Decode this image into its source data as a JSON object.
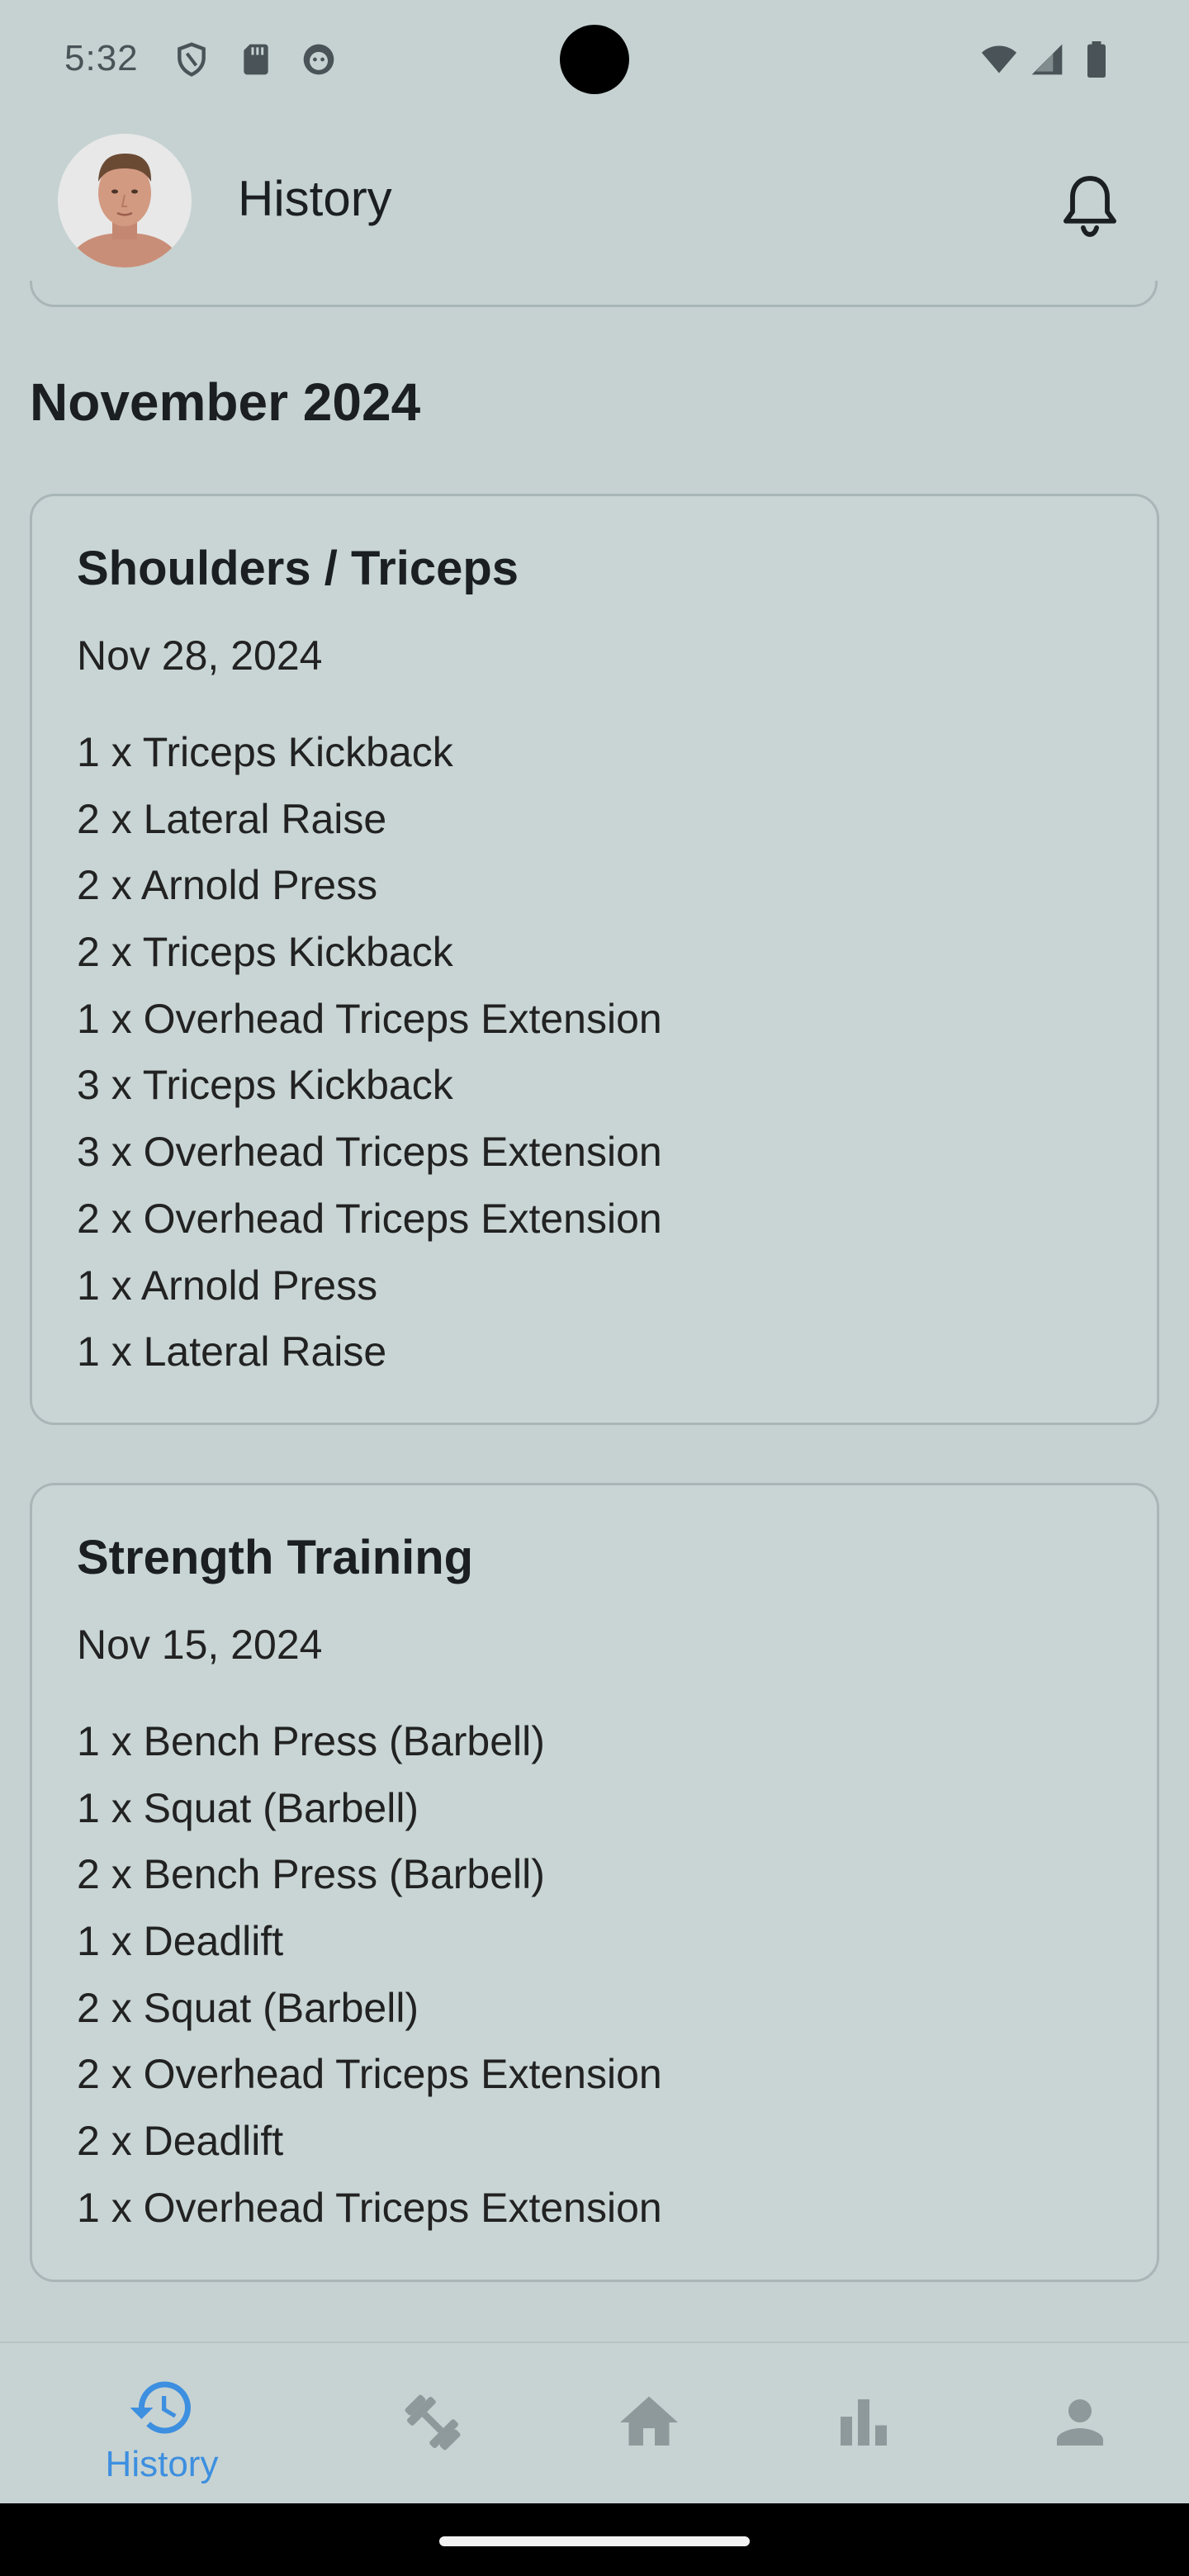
{
  "status_bar": {
    "time": "5:32",
    "icons": [
      "shield-icon",
      "sd-card-icon",
      "game-icon",
      "wifi-icon",
      "signal-icon",
      "battery-icon"
    ]
  },
  "header": {
    "title": "History",
    "avatar": "profile-photo",
    "action_icon": "bell-icon"
  },
  "month": "November 2024",
  "workouts": [
    {
      "title": "Shoulders / Triceps",
      "date": "Nov 28, 2024",
      "exercises": [
        "1 x Triceps Kickback",
        "2 x Lateral Raise",
        "2 x Arnold Press",
        "2 x Triceps Kickback",
        "1 x Overhead Triceps Extension",
        "3 x Triceps Kickback",
        "3 x Overhead Triceps Extension",
        "2 x Overhead Triceps Extension",
        "1 x Arnold Press",
        "1 x Lateral Raise"
      ]
    },
    {
      "title": "Strength Training",
      "date": "Nov 15, 2024",
      "exercises": [
        "1 x Bench Press (Barbell)",
        "1 x Squat (Barbell)",
        "2 x Bench Press (Barbell)",
        "1 x Deadlift",
        "2 x Squat (Barbell)",
        "2 x Overhead Triceps Extension",
        "2 x Deadlift",
        "1 x Overhead Triceps Extension"
      ]
    }
  ],
  "bottom_nav": {
    "items": [
      {
        "label": "History",
        "icon": "history-icon",
        "active": true
      },
      {
        "label": "",
        "icon": "workout-icon",
        "active": false
      },
      {
        "label": "",
        "icon": "home-icon",
        "active": false
      },
      {
        "label": "",
        "icon": "stats-icon",
        "active": false
      },
      {
        "label": "",
        "icon": "profile-icon",
        "active": false
      }
    ]
  },
  "colors": {
    "background": "#c5d2d1",
    "accent": "#3d8fe0",
    "inactive_icon": "#8e999c",
    "card_border": "#a9b6b7"
  }
}
